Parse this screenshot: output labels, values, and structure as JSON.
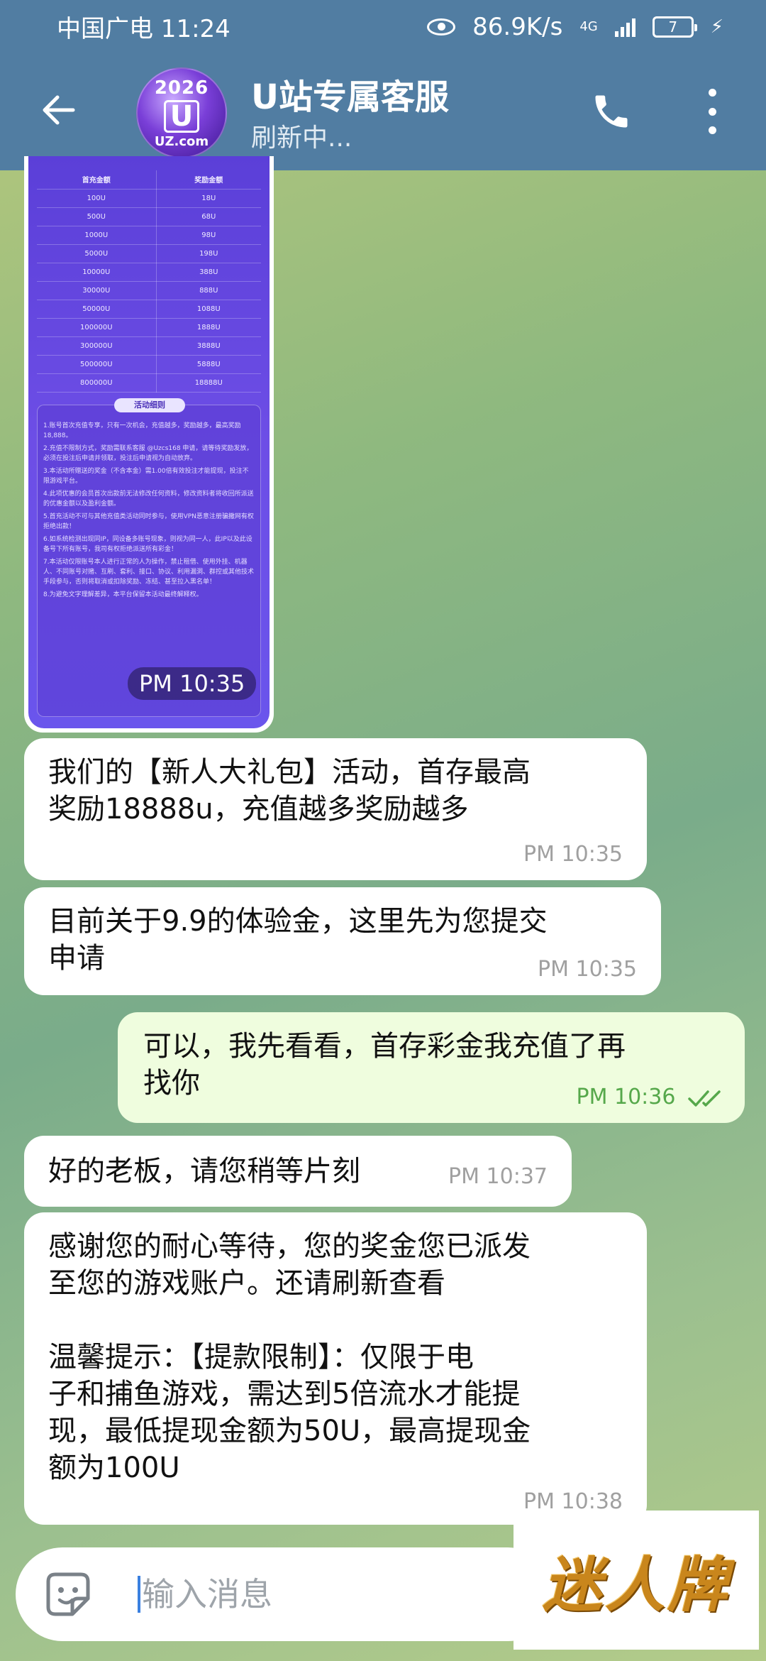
{
  "statusbar": {
    "carrier_time": "中国广电 11:24",
    "speed": "86.9K/s",
    "network": "4G",
    "battery": "7"
  },
  "header": {
    "title": "U站专属客服",
    "subtitle": "刷新中...",
    "avatar_year": "2026",
    "avatar_letter": "U",
    "avatar_domain": "UZ.com"
  },
  "promo": {
    "col_deposit": "首充金额",
    "col_bonus": "奖励金额",
    "rows": [
      [
        "100U",
        "18U"
      ],
      [
        "500U",
        "68U"
      ],
      [
        "1000U",
        "98U"
      ],
      [
        "5000U",
        "198U"
      ],
      [
        "10000U",
        "388U"
      ],
      [
        "30000U",
        "888U"
      ],
      [
        "50000U",
        "1088U"
      ],
      [
        "100000U",
        "1888U"
      ],
      [
        "300000U",
        "3888U"
      ],
      [
        "500000U",
        "5888U"
      ],
      [
        "800000U",
        "18888U"
      ]
    ],
    "rules_title": "活动细则",
    "rules": [
      "1.账号首次充值专享，只有一次机会，充值越多，奖励越多，最高奖励18,888。",
      "2.充值不限制方式，奖励需联系客服 @Uzcs168 申请，请等待奖励发放，必须在投注后申请并领取，投注后申请视为自动放弃。",
      "3.本活动所赠送的奖金（不含本金）需1.00倍有效投注才能提现，投注不限游戏平台。",
      "4.此项优惠的会员首次出款前无法修改任何资料，修改资料者将收回所派送的优惠金额以及盈利金额。",
      "5.首充活动不可与其他充值类活动同时参与，使用VPN恶意注册骗撒网有权拒绝出款！",
      "6.如系统检测出现同IP，同设备多账号现象，则视为同一人，此IP以及此设备号下所有账号，我司有权拒绝派送所有彩金！",
      "7.本活动仅限账号本人进行正常的人为操作，禁止租借、使用外挂、机器人、不同账号对赌、互刷、套利、接口、协议、利用漏洞、群控或其他技术手段参与，否则将取消或扣除奖励、冻结、甚至拉入黑名单！",
      "8.为避免文字理解差异，本平台保留本活动最终解释权。"
    ],
    "time": "PM 10:35"
  },
  "messages": [
    {
      "text": "我们的【新人大礼包】活动，首存最高\n奖励18888u，充值越多奖励越多",
      "time": "PM 10:35"
    },
    {
      "text": "目前关于9.9的体验金，这里先为您提交\n申请",
      "time": "PM 10:35"
    },
    {
      "text": "可以，我先看看，首存彩金我充值了再\n找你",
      "time": "PM 10:36"
    },
    {
      "text": "好的老板，请您稍等片刻",
      "time": "PM 10:37"
    },
    {
      "text": "感谢您的耐心等待，您的奖金您已派发\n至您的游戏账户。还请刷新查看\n\n温馨提示：【提款限制】：仅限于电\n子和捕鱼游戏，需达到5倍流水才能提\n现，最低提现金额为50U，最高提现金\n额为100U",
      "time": "PM 10:38"
    }
  ],
  "input": {
    "placeholder": "输入消息"
  },
  "watermark": "迷人牌",
  "colors": {
    "header": "#517da2",
    "outgoing": "#effdde",
    "incoming": "#ffffff",
    "check": "#56a84b"
  }
}
